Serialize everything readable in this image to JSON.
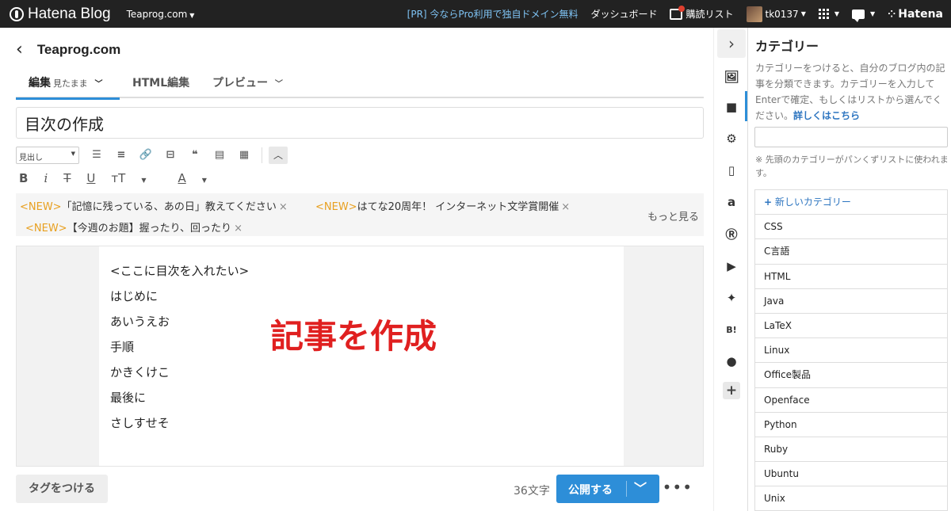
{
  "topbar": {
    "logo_text": "Hatena Blog",
    "blog_select": "Teaprog.com",
    "pr_text": "[PR] 今ならPro利用で独自ドメイン無料",
    "dashboard": "ダッシュボード",
    "reader": "購読リスト",
    "user": "tk0137",
    "brand": "Hatena"
  },
  "editor": {
    "blog_title": "Teaprog.com",
    "tabs": {
      "edit": "編集",
      "edit_mode": "見たまま",
      "html": "HTML編集",
      "preview": "プレビュー"
    },
    "title_value": "目次の作成",
    "heading_select": "見出し",
    "format_buttons": {
      "bold": "B",
      "italic": "i",
      "strike": "T",
      "underline": "U",
      "size": "тT",
      "color": "A"
    },
    "news": [
      {
        "tag": "<NEW>",
        "text": "「記憶に残っている、あの日」教えてください"
      },
      {
        "tag": "<NEW>",
        "text": "はてな20周年！ インターネット文学賞開催"
      },
      {
        "tag": "<NEW>",
        "text": "【今週のお題】握ったり、回ったり"
      }
    ],
    "news_close": "×",
    "news_more": "もっと見る",
    "body_lines": [
      "<ここに目次を入れたい>",
      "はじめに",
      "あいうえお",
      "手順",
      "かきくけこ",
      "最後に",
      "さしすせそ"
    ],
    "annotation": "記事を作成",
    "tag_button": "タグをつける",
    "char_count": "36文字",
    "publish_button": "公開する",
    "more_button": "•••"
  },
  "sidebar": {
    "title": "カテゴリー",
    "description": "カテゴリーをつけると、自分のブログ内の記事を分類できます。カテゴリーを入力してEnterで確定、もしくはリストから選んでください。",
    "details_link": "詳しくはこちら",
    "note": "※ 先頭のカテゴリーがパンくずリストに使われます。",
    "new_category": "新しいカテゴリー",
    "categories": [
      "CSS",
      "C言語",
      "HTML",
      "Java",
      "LaTeX",
      "Linux",
      "Office製品",
      "Openface",
      "Python",
      "Ruby",
      "Ubuntu",
      "Unix"
    ]
  }
}
